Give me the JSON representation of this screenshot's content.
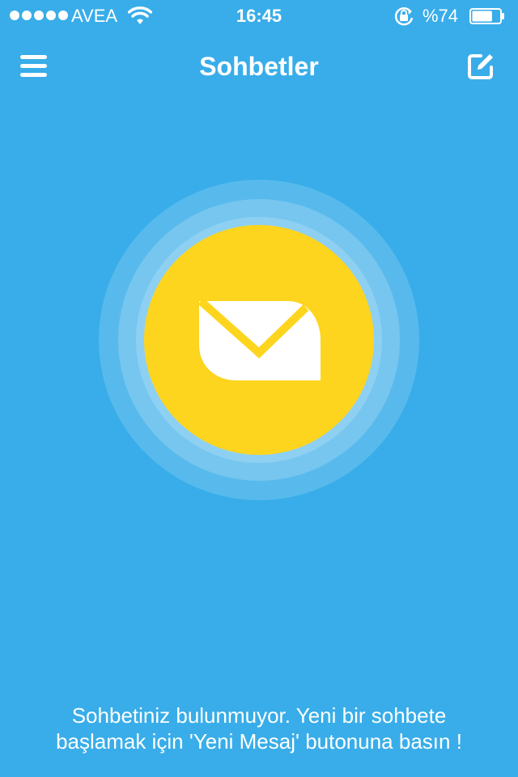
{
  "status_bar": {
    "carrier": "AVEA",
    "time": "16:45",
    "battery_percent": "%74",
    "battery_level": 0.74
  },
  "nav": {
    "title": "Sohbetler"
  },
  "empty_state": {
    "message": "Sohbetiniz bulunmuyor. Yeni bir sohbete başlamak için 'Yeni Mesaj' butonuna basın !"
  },
  "colors": {
    "background": "#38ade9",
    "accent_yellow": "#fdd51e"
  }
}
